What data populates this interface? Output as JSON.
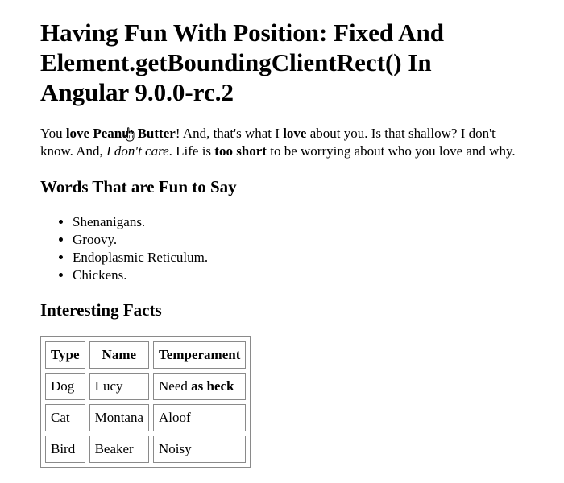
{
  "title": "Having Fun With Position: Fixed And Element.getBoundingClientRect() In Angular 9.0.0-rc.2",
  "intro": {
    "t1": "You ",
    "b1": "love Peanut Butter",
    "t2": "! And, that's what I ",
    "b2": "love",
    "t3": " about you. Is that shallow? I don't know. And, ",
    "i1": "I don't care",
    "t4": ". Life is ",
    "b3": "too short",
    "t5": " to be worrying about who you love and why."
  },
  "words_section": {
    "heading": "Words That are Fun to Say",
    "items": [
      "Shenanigans.",
      "Groovy.",
      "Endoplasmic Reticulum.",
      "Chickens."
    ]
  },
  "facts_section": {
    "heading": "Interesting Facts",
    "columns": [
      "Type",
      "Name",
      "Temperament"
    ],
    "rows": [
      {
        "type": "Dog",
        "name": "Lucy",
        "temperament": "Need ",
        "temperament_bold": "as heck"
      },
      {
        "type": "Cat",
        "name": "Montana",
        "temperament": "Aloof",
        "temperament_bold": ""
      },
      {
        "type": "Bird",
        "name": "Beaker",
        "temperament": "Noisy",
        "temperament_bold": ""
      }
    ]
  },
  "cursor": {
    "icon": "hand-pointer-icon"
  }
}
